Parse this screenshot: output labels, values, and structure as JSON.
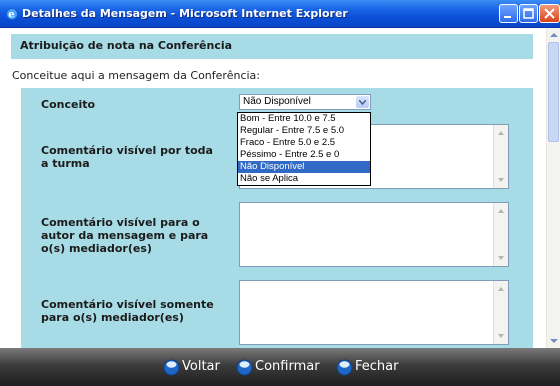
{
  "window": {
    "title": "Detalhes da Mensagem - Microsoft Internet Explorer"
  },
  "page": {
    "header_title": "Atribuição de nota na Conferência",
    "intro": "Conceitue aqui a mensagem da Conferência:"
  },
  "form": {
    "conceito_label": "Conceito",
    "conceito_selected": "Não Disponível",
    "options": [
      "Bom - Entre 10.0 e 7.5",
      "Regular - Entre 7.5 e 5.0",
      "Fraco - Entre 5.0 e 2.5",
      "Péssimo - Entre 2.5 e 0",
      "Não Disponível",
      "Não se Aplica"
    ],
    "comment_turma_label": "Comentário visível por toda a turma",
    "comment_autor_label": "Comentário visível para o autor da mensagem e para o(s) mediador(es)",
    "comment_mediador_label": "Comentário visível somente para o(s) mediador(es)"
  },
  "buttons": {
    "voltar": "Voltar",
    "confirmar": "Confirmar",
    "fechar": "Fechar"
  },
  "colors": {
    "panel": "#a7dbe6",
    "titlebar": "#0b4fd6",
    "selection": "#316ac5"
  }
}
